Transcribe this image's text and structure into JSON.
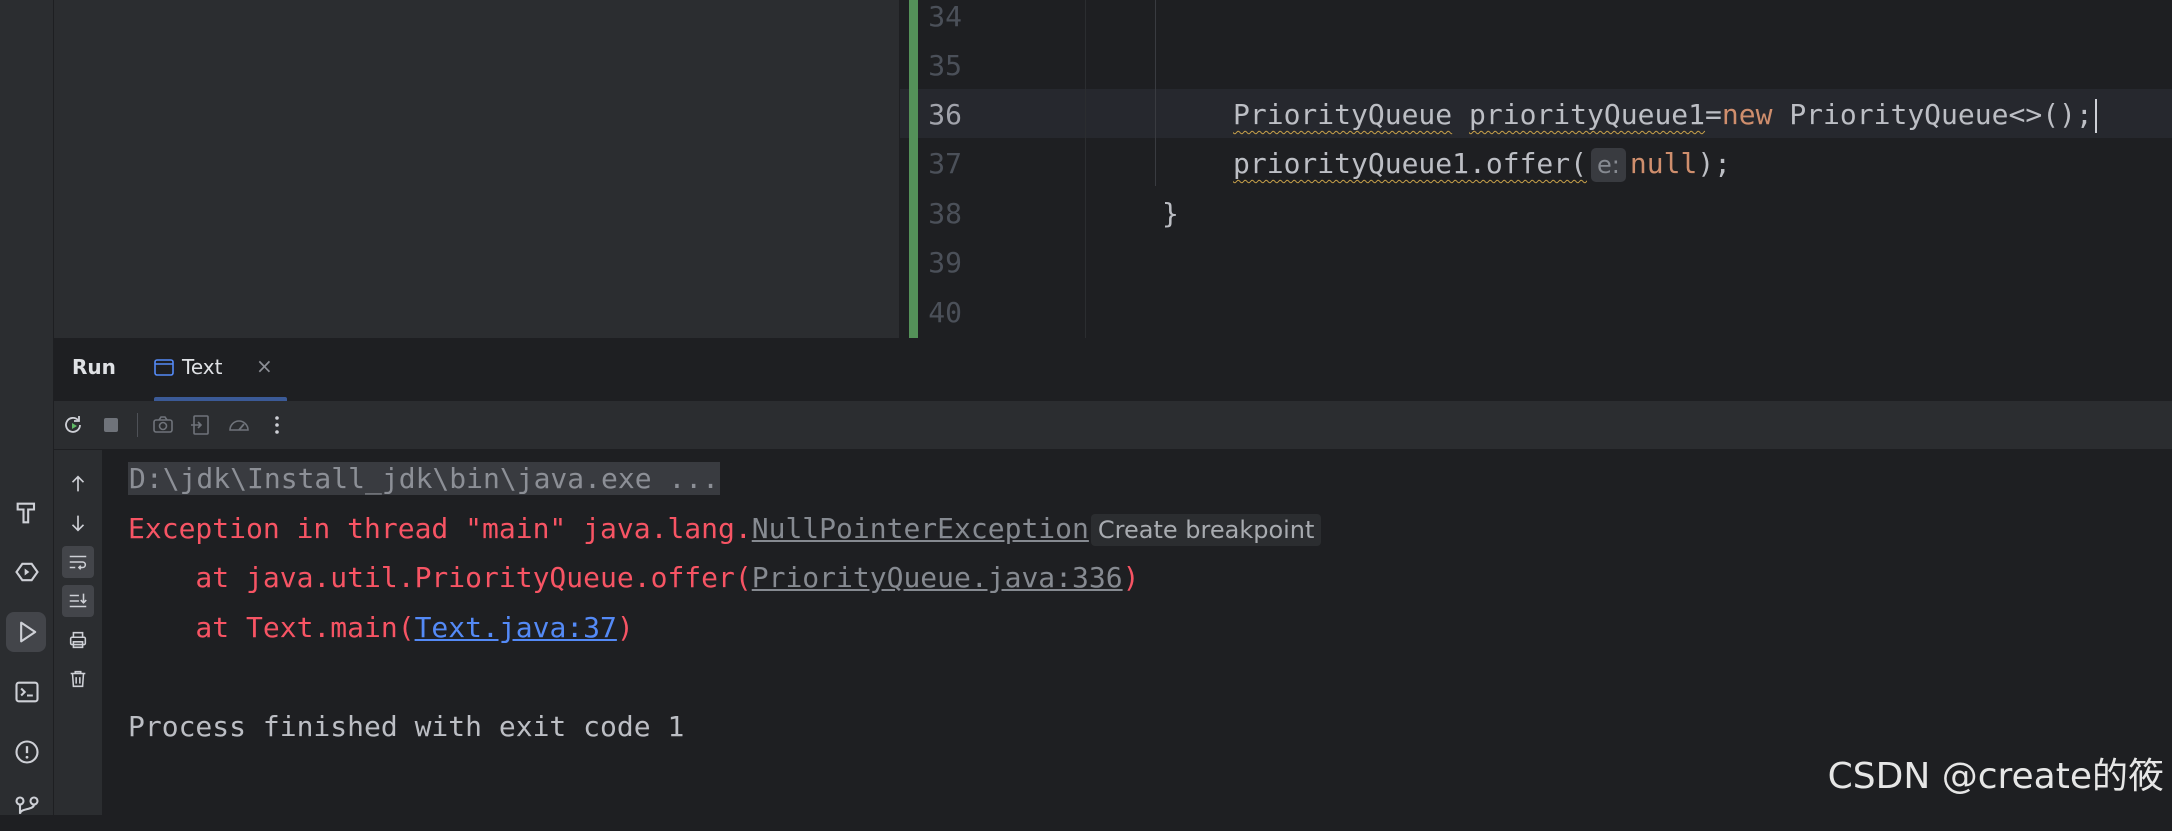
{
  "editor": {
    "line_numbers": [
      "34",
      "35",
      "36",
      "37",
      "38",
      "39",
      "40"
    ],
    "current_line": "36",
    "line36": {
      "type1": "PriorityQueue",
      "var1": "priorityQueue1",
      "eq": "=",
      "kw_new": "new",
      "ctor": " PriorityQueue<>();"
    },
    "line37": {
      "call": "priorityQueue1.offer(",
      "param_hint": "e:",
      "kw_null": "null",
      "end": ");"
    },
    "line38": "}"
  },
  "run_panel": {
    "title": "Run",
    "tab_label": "Text",
    "tab_close": "×"
  },
  "console": {
    "command": "D:\\jdk\\Install_jdk\\bin\\java.exe ...",
    "exception_prefix": "Exception in thread \"main\" java.lang.",
    "exception_class": "NullPointerException",
    "breakpoint_chip": "Create breakpoint",
    "trace1_prefix": "    at java.util.PriorityQueue.offer(",
    "trace1_link": "PriorityQueue.java:336",
    "trace1_suffix": ")",
    "trace2_prefix": "    at Text.main(",
    "trace2_link": "Text.java:37",
    "trace2_suffix": ")",
    "exit_message": "Process finished with exit code 1"
  },
  "watermark": "CSDN @create的筱",
  "icons": {
    "activity_bar": [
      "build-hammer-icon",
      "services-icon",
      "run-icon",
      "terminal-icon",
      "problems-icon",
      "git-icon"
    ],
    "toolbar": [
      "rerun-icon",
      "stop-icon",
      "camera-icon",
      "export-icon",
      "speed-icon",
      "more-icon"
    ],
    "console_side": [
      "up-arrow-icon",
      "down-arrow-icon",
      "soft-wrap-icon",
      "scroll-to-end-icon",
      "print-icon",
      "trash-icon"
    ]
  },
  "colors": {
    "error": "#f75464",
    "link": "#548af7",
    "keyword": "#cf8e6d",
    "git_added": "#549159"
  }
}
